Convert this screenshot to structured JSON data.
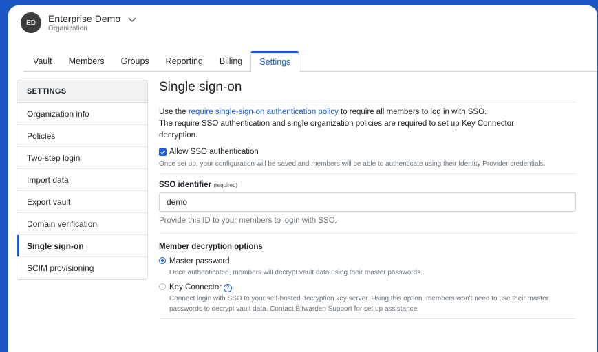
{
  "header": {
    "avatar_initials": "ED",
    "org_name": "Enterprise Demo",
    "org_type": "Organization"
  },
  "tabs": [
    {
      "label": "Vault"
    },
    {
      "label": "Members"
    },
    {
      "label": "Groups"
    },
    {
      "label": "Reporting"
    },
    {
      "label": "Billing"
    },
    {
      "label": "Settings",
      "active": true
    }
  ],
  "sidebar": {
    "heading": "SETTINGS",
    "items": [
      {
        "label": "Organization info"
      },
      {
        "label": "Policies"
      },
      {
        "label": "Two-step login"
      },
      {
        "label": "Import data"
      },
      {
        "label": "Export vault"
      },
      {
        "label": "Domain verification"
      },
      {
        "label": "Single sign-on",
        "active": true
      },
      {
        "label": "SCIM provisioning"
      }
    ]
  },
  "main": {
    "title": "Single sign-on",
    "intro_prefix": "Use the ",
    "intro_link": "require single-sign-on authentication policy",
    "intro_suffix": " to require all members to log in with SSO.",
    "intro_line2": "The require SSO authentication and single organization policies are required to set up Key Connector decryption.",
    "allow_sso_label": "Allow SSO authentication",
    "allow_sso_checked": true,
    "allow_sso_help": "Once set up, your configuration will be saved and members will be able to authenticate using their Identity Provider credentials.",
    "sso_identifier_label": "SSO identifier",
    "sso_identifier_required": "(required)",
    "sso_identifier_value": "demo",
    "sso_identifier_help": "Provide this ID to your members to login with SSO.",
    "decryption_heading": "Member decryption options",
    "options": [
      {
        "label": "Master password",
        "selected": true,
        "help": "Once authenticated, members will decrypt vault data using their master passwords."
      },
      {
        "label": "Key Connector",
        "selected": false,
        "help": "Connect login with SSO to your self-hosted decryption key server. Using this option, members won't need to use their master passwords to decrypt vault data. Contact Bitwarden Support for set up assistance."
      }
    ]
  },
  "colors": {
    "accent": "#175ddc",
    "background": "#1a56c4"
  }
}
